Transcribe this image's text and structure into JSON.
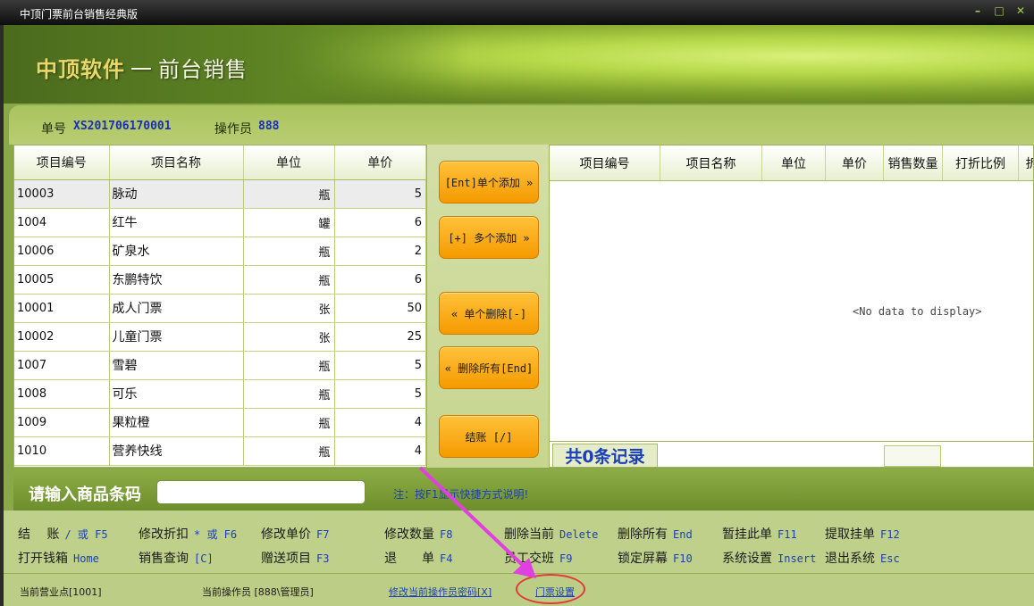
{
  "window": {
    "title": "中顶门票前台销售经典版",
    "controls": [
      "–",
      "□",
      "✕"
    ]
  },
  "banner": {
    "brand": "中顶软件",
    "dash": "一",
    "subtitle": "前台销售"
  },
  "info": {
    "order_label": "单号",
    "order_no": "XS201706170001",
    "operator_label": "操作员",
    "operator": "888"
  },
  "left_grid": {
    "columns": [
      "项目编号",
      "项目名称",
      "单位",
      "单价"
    ],
    "rows": [
      [
        "10003",
        "脉动",
        "瓶",
        "5"
      ],
      [
        "1004",
        "红牛",
        "罐",
        "6"
      ],
      [
        "10006",
        "矿泉水",
        "瓶",
        "2"
      ],
      [
        "10005",
        "东鹏特饮",
        "瓶",
        "6"
      ],
      [
        "10001",
        "成人门票",
        "张",
        "50"
      ],
      [
        "10002",
        "儿童门票",
        "张",
        "25"
      ],
      [
        "1007",
        "雪碧",
        "瓶",
        "5"
      ],
      [
        "1008",
        "可乐",
        "瓶",
        "5"
      ],
      [
        "1009",
        "果粒橙",
        "瓶",
        "4"
      ],
      [
        "1010",
        "营养快线",
        "瓶",
        "4"
      ]
    ]
  },
  "actions": {
    "add_single": "[Ent]单个添加 »",
    "add_multi": "[+] 多个添加 »",
    "del_single": "« 单个删除[-]",
    "del_all": "« 删除所有[End]",
    "checkout": "结账 [/]"
  },
  "right_grid": {
    "columns": [
      "项目编号",
      "项目名称",
      "单位",
      "单价",
      "销售数量",
      "打折比例",
      "折"
    ],
    "empty_text": "<No data to display>",
    "record_count": "共0条记录"
  },
  "barcode": {
    "label": "请输入商品条码",
    "value": "",
    "note": "注：按F1显示快捷方式说明!"
  },
  "shortcuts": [
    {
      "label": "结　 账",
      "key": "/ 或 F5"
    },
    {
      "label": "修改折扣",
      "key": "* 或 F6"
    },
    {
      "label": "修改单价",
      "key": "F7"
    },
    {
      "label": "修改数量",
      "key": "F8"
    },
    {
      "label": "删除当前",
      "key": "Delete"
    },
    {
      "label": "删除所有",
      "key": "End"
    },
    {
      "label": "暂挂此单",
      "key": "F11"
    },
    {
      "label": "提取挂单",
      "key": "F12"
    },
    {
      "label": "打开钱箱",
      "key": "Home"
    },
    {
      "label": "销售查询",
      "key": "[C]"
    },
    {
      "label": "赠送项目",
      "key": "F3"
    },
    {
      "label": "退　　单",
      "key": "F4"
    },
    {
      "label": "员工交班",
      "key": "F9"
    },
    {
      "label": "锁定屏幕",
      "key": "F10"
    },
    {
      "label": "系统设置",
      "key": "Insert"
    },
    {
      "label": "退出系统",
      "key": "Esc"
    }
  ],
  "status": {
    "point": "当前营业点[1001]",
    "operator": "当前操作员 [888\\管理员]",
    "change_pwd": "修改当前操作员密码[X]",
    "ticket_settings": "门票设置"
  },
  "annotation": {
    "color": "#e23a3a",
    "arrow_color": "#e040e0"
  }
}
